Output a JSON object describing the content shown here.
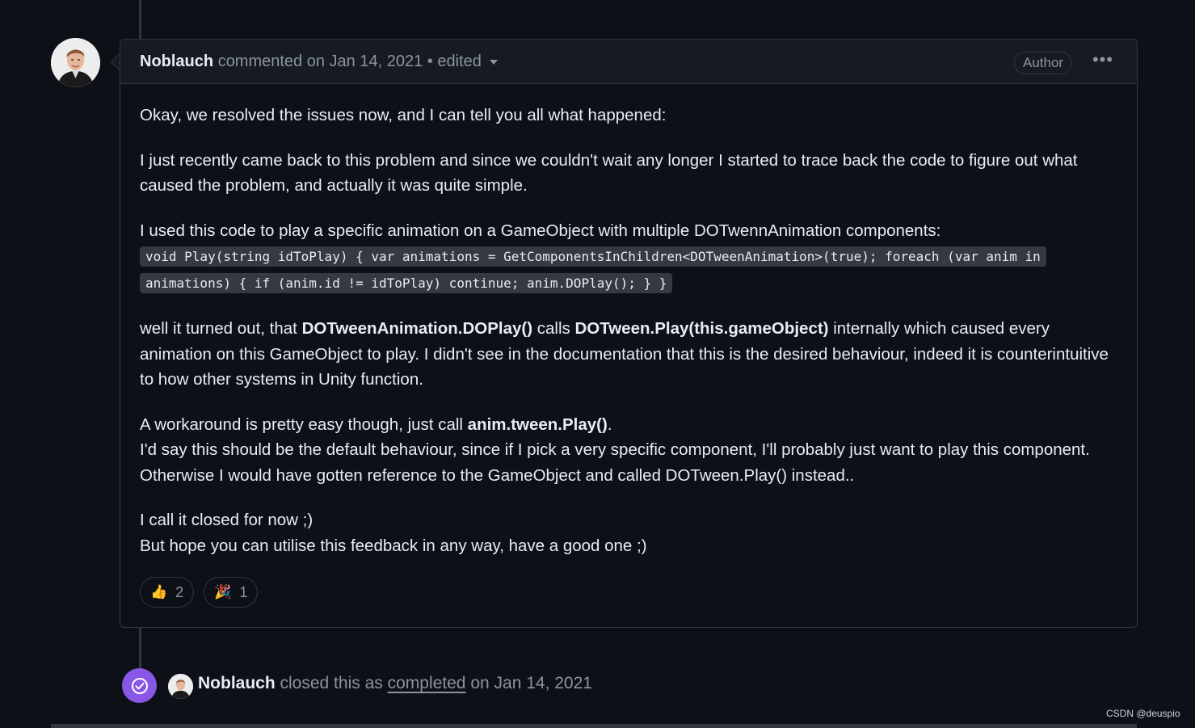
{
  "comment": {
    "author": "Noblauch",
    "action_text": "commented on Jan 14, 2021",
    "separator": "•",
    "edited_label": "edited",
    "author_badge": "Author",
    "more_label": "•••",
    "body": {
      "p1": "Okay, we resolved the issues now, and I can tell you all what happened:",
      "p2": "I just recently came back to this problem and since we couldn't wait any longer I started to trace back the code to figure out what caused the problem, and actually it was quite simple.",
      "p3_text": "I used this code to play a specific animation on a GameObject with multiple DOTwennAnimation components:",
      "p3_code": "void Play(string idToPlay) { var animations = GetComponentsInChildren<DOTweenAnimation>(true); foreach (var anim in animations) { if (anim.id != idToPlay) continue; anim.DOPlay(); } }",
      "p4_a": "well it turned out, that ",
      "p4_b": "DOTweenAnimation.DOPlay()",
      "p4_c": " calls ",
      "p4_d": "DOTween.Play(this.gameObject)",
      "p4_e": " internally which caused every animation on this GameObject to play. I didn't see in the documentation that this is the desired behaviour, indeed it is counterintuitive to how other systems in Unity function.",
      "p5_a": "A workaround is pretty easy though, just call ",
      "p5_b": "anim.tween.Play()",
      "p5_c": ".",
      "p5_line2": "I'd say this should be the default behaviour, since if I pick a very specific component, I'll probably just want to play this component.",
      "p5_line3": "Otherwise I would have gotten reference to the GameObject and called DOTween.Play() instead..",
      "p6_line1": "I call it closed for now ;)",
      "p6_line2": "But hope you can utilise this feedback in any way, have a good one ;)"
    },
    "reactions": [
      {
        "emoji": "👍",
        "icon": "thumbs-up-icon",
        "count": "2"
      },
      {
        "emoji": "🎉",
        "icon": "party-popper-icon",
        "count": "1"
      }
    ]
  },
  "event": {
    "author": "Noblauch",
    "text_before": "closed this as",
    "link_text": "completed",
    "text_after": "on Jan 14, 2021",
    "icon": "check-circle-icon",
    "icon_color": "#8957e5"
  },
  "watermark": "CSDN @deuspio",
  "colors": {
    "background": "#0d1117",
    "header": "#161b22",
    "border": "#30363d",
    "text": "#e6edf3",
    "muted": "#8b949e"
  }
}
